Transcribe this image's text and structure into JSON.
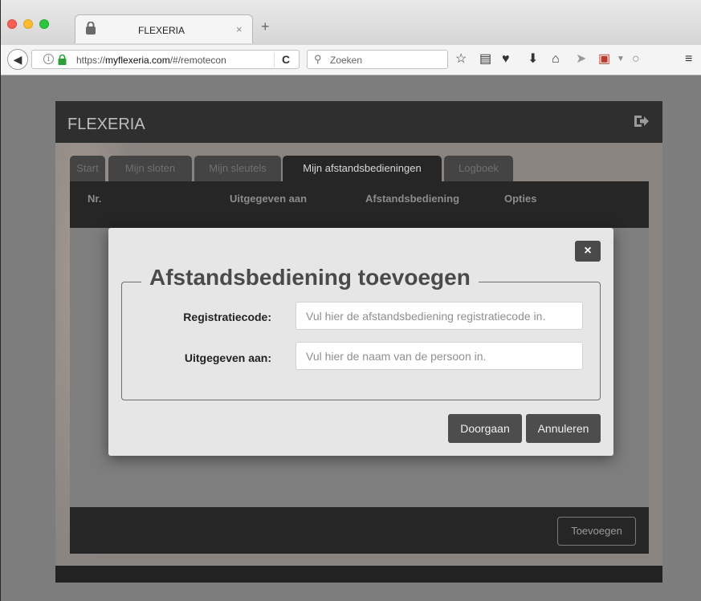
{
  "browser": {
    "tab_title": "FLEXERIA",
    "tab_close": "×",
    "new_tab": "+",
    "url_prefix": "https://",
    "url_domain": "myflexeria.com",
    "url_path": "/#/remotecon",
    "search_placeholder": "Zoeken",
    "toolbar_icons": [
      "bookmark-star-icon",
      "reading-list-icon",
      "pocket-icon",
      "download-icon",
      "home-icon",
      "send-icon",
      "pdf-icon",
      "hello-icon",
      "menu-icon"
    ]
  },
  "app": {
    "logo": "FLEXERIA",
    "tabs": [
      {
        "label": "Start",
        "active": false
      },
      {
        "label": "Mijn sloten",
        "active": false
      },
      {
        "label": "Mijn sleutels",
        "active": false
      },
      {
        "label": "Mijn afstandsbedieningen",
        "active": true
      },
      {
        "label": "Logboek",
        "active": false
      }
    ],
    "table_headers": [
      "Nr.",
      "Uitgegeven aan",
      "Afstandsbediening",
      "Opties"
    ],
    "add_button": "Toevoegen"
  },
  "modal": {
    "close_label": "×",
    "title": "Afstandsbediening toevoegen",
    "fields": [
      {
        "label": "Registratiecode:",
        "value": "",
        "placeholder": "Vul hier de afstandsbediening registratiecode in."
      },
      {
        "label": "Uitgegeven aan:",
        "value": "",
        "placeholder": "Vul hier de naam van de persoon in."
      }
    ],
    "continue_button": "Doorgaan",
    "cancel_button": "Annuleren"
  }
}
